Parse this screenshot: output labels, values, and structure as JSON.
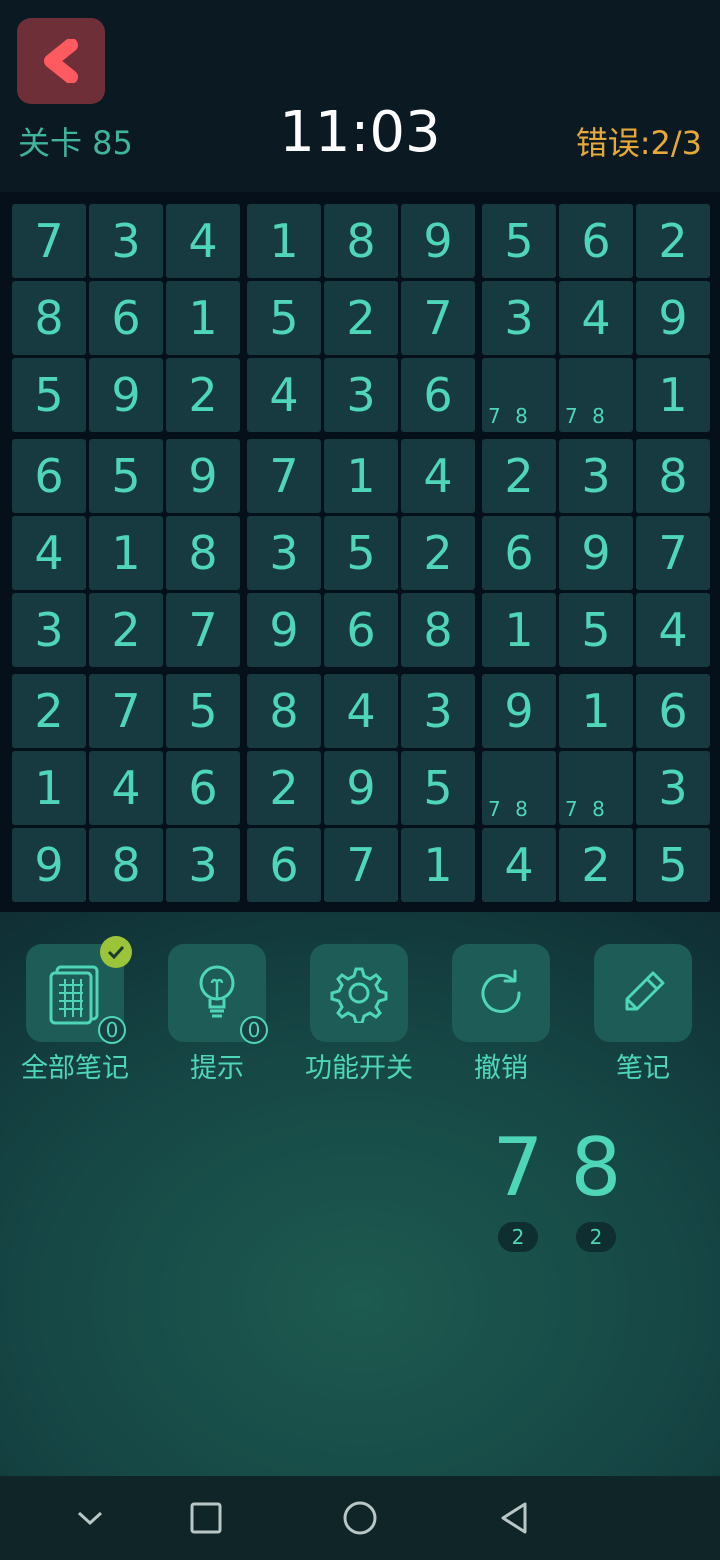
{
  "header": {
    "level_label": "关卡 85",
    "timer": "11:03",
    "errors_label": "错误:2/3"
  },
  "board": {
    "grid": [
      [
        "7",
        "3",
        "4",
        "1",
        "8",
        "9",
        "5",
        "6",
        "2"
      ],
      [
        "8",
        "6",
        "1",
        "5",
        "2",
        "7",
        "3",
        "4",
        "9"
      ],
      [
        "5",
        "9",
        "2",
        "4",
        "3",
        "6",
        "",
        "",
        "1"
      ],
      [
        "6",
        "5",
        "9",
        "7",
        "1",
        "4",
        "2",
        "3",
        "8"
      ],
      [
        "4",
        "1",
        "8",
        "3",
        "5",
        "2",
        "6",
        "9",
        "7"
      ],
      [
        "3",
        "2",
        "7",
        "9",
        "6",
        "8",
        "1",
        "5",
        "4"
      ],
      [
        "2",
        "7",
        "5",
        "8",
        "4",
        "3",
        "9",
        "1",
        "6"
      ],
      [
        "1",
        "4",
        "6",
        "2",
        "9",
        "5",
        "",
        "",
        "3"
      ],
      [
        "9",
        "8",
        "3",
        "6",
        "7",
        "1",
        "4",
        "2",
        "5"
      ]
    ],
    "notes": [
      {
        "row": 2,
        "col": 6,
        "text": "7 8"
      },
      {
        "row": 2,
        "col": 7,
        "text": "7 8"
      },
      {
        "row": 7,
        "col": 6,
        "text": "7 8"
      },
      {
        "row": 7,
        "col": 7,
        "text": "7 8"
      }
    ]
  },
  "tools": [
    {
      "label": "全部笔记",
      "icon": "grid-notes-icon",
      "count": "0",
      "checked": true
    },
    {
      "label": "提示",
      "icon": "lightbulb-icon",
      "count": "0"
    },
    {
      "label": "功能开关",
      "icon": "gear-icon"
    },
    {
      "label": "撤销",
      "icon": "undo-icon"
    },
    {
      "label": "笔记",
      "icon": "pencil-icon"
    }
  ],
  "number_picker": [
    {
      "number": "7",
      "remaining": "2"
    },
    {
      "number": "8",
      "remaining": "2"
    }
  ],
  "colors": {
    "accent": "#4fd6b8",
    "error": "#e7a83a",
    "back_button": "#6e2f38",
    "back_arrow": "#ff5a5f",
    "check_badge": "#9bc43a"
  }
}
